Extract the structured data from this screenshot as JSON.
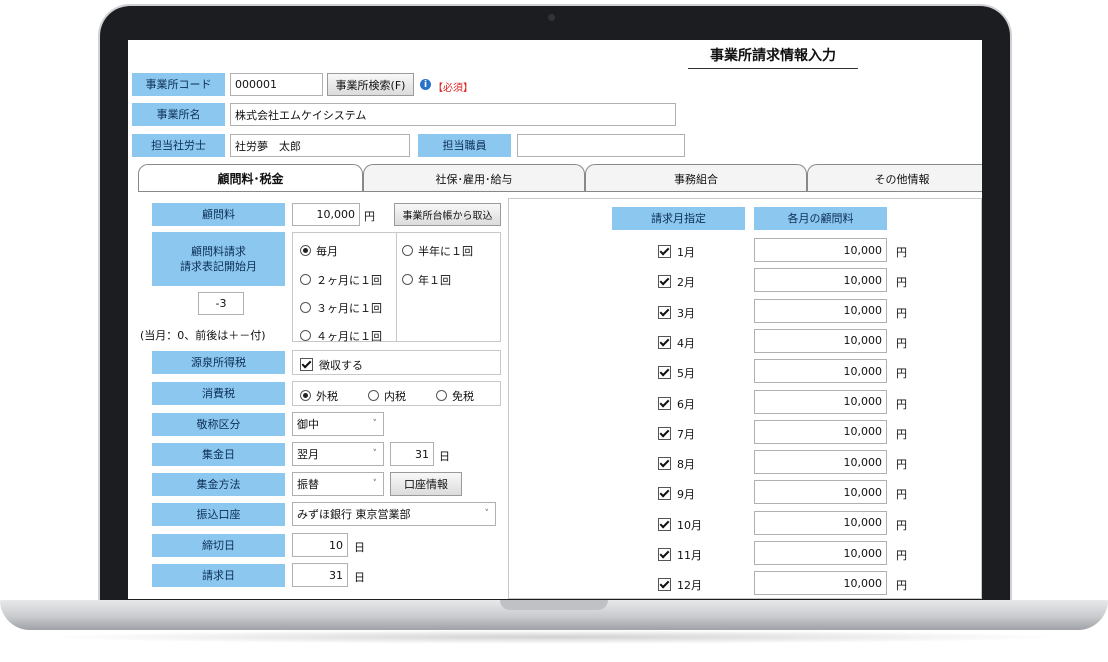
{
  "title": "事業所請求情報入力",
  "office_code": {
    "label": "事業所コード",
    "value": "000001",
    "search_button": "事業所検索(F)",
    "required": "【必須】"
  },
  "office_name": {
    "label": "事業所名",
    "value": "株式会社エムケイシステム"
  },
  "consultant": {
    "label": "担当社労士",
    "value": "社労夢　太郎",
    "staff_label": "担当職員",
    "staff_value": ""
  },
  "tabs": [
    "顧問料･税金",
    "社保･雇用･給与",
    "事務組合",
    "その他情報"
  ],
  "fee": {
    "label": "顧問料",
    "value": "10,000",
    "unit": "円",
    "import_button": "事業所台帳から取込"
  },
  "billing_start": {
    "label_line1": "顧問料請求",
    "label_line2": "請求表記開始月",
    "offset_value": "-3",
    "note": "(当月：0、前後は＋－付)"
  },
  "frequency": {
    "options": [
      "毎月",
      "半年に１回",
      "２ヶ月に１回",
      "年１回",
      "３ヶ月に１回",
      "４ヶ月に１回"
    ],
    "selected": "毎月"
  },
  "withholding": {
    "label": "源泉所得税",
    "checkbox_label": "徴収する"
  },
  "consumption_tax": {
    "label": "消費税",
    "options": [
      "外税",
      "内税",
      "免税"
    ],
    "selected": "外税"
  },
  "honorific": {
    "label": "敬称区分",
    "value": "御中"
  },
  "collection_day": {
    "label": "集金日",
    "month": "翌月",
    "day": "31",
    "unit": "日"
  },
  "collection_method": {
    "label": "集金方法",
    "value": "振替",
    "account_button": "口座情報"
  },
  "transfer_account": {
    "label": "振込口座",
    "value": "みずほ銀行 東京営業部"
  },
  "closing_day": {
    "label": "締切日",
    "value": "10",
    "unit": "日"
  },
  "billing_day": {
    "label": "請求日",
    "value": "31",
    "unit": "日"
  },
  "monthly": {
    "header_month": "請求月指定",
    "header_fee": "各月の顧問料",
    "unit": "円",
    "rows": [
      {
        "month": "1月",
        "fee": "10,000"
      },
      {
        "month": "2月",
        "fee": "10,000"
      },
      {
        "month": "3月",
        "fee": "10,000"
      },
      {
        "month": "4月",
        "fee": "10,000"
      },
      {
        "month": "5月",
        "fee": "10,000"
      },
      {
        "month": "6月",
        "fee": "10,000"
      },
      {
        "month": "7月",
        "fee": "10,000"
      },
      {
        "month": "8月",
        "fee": "10,000"
      },
      {
        "month": "9月",
        "fee": "10,000"
      },
      {
        "month": "10月",
        "fee": "10,000"
      },
      {
        "month": "11月",
        "fee": "10,000"
      },
      {
        "month": "12月",
        "fee": "10,000"
      }
    ]
  },
  "colors": {
    "label_bg": "#8cc7f0",
    "required": "#e02020",
    "bezel": "#1c1d20"
  }
}
